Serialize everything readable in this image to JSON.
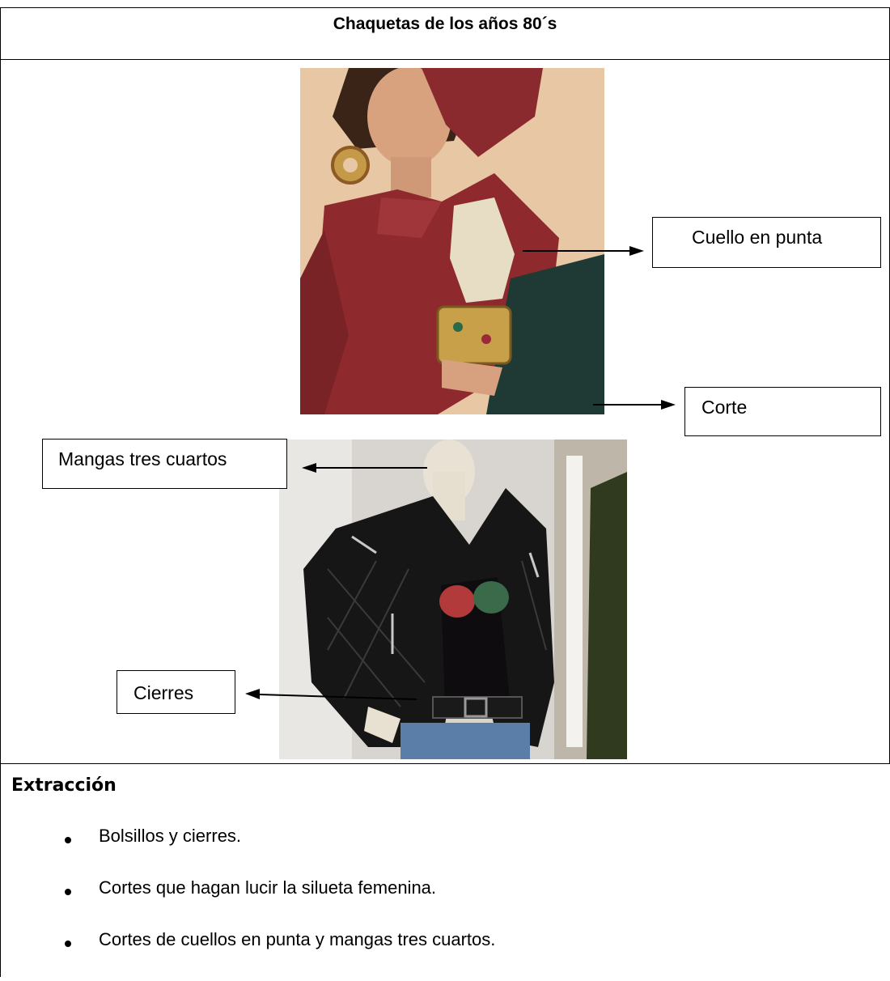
{
  "header": {
    "title": "Chaquetas de los años  80´s"
  },
  "images": {
    "top": {
      "description_icon": "photo-red-jacket"
    },
    "bottom": {
      "description_icon": "photo-leather-jacket"
    }
  },
  "annotations": {
    "cuello": "Cuello en punta",
    "corte": "Corte",
    "mangas": "Mangas tres cuartos",
    "cierres": "Cierres"
  },
  "extraction": {
    "heading": "Extracción",
    "items": [
      "Bolsillos y cierres.",
      "Cortes que hagan lucir la silueta femenina.",
      "Cortes de cuellos en punta y mangas tres cuartos."
    ]
  },
  "colors": {
    "jacket_red": "#8e2a2a",
    "leather_black": "#141414",
    "skin": "#e7c5a3"
  }
}
